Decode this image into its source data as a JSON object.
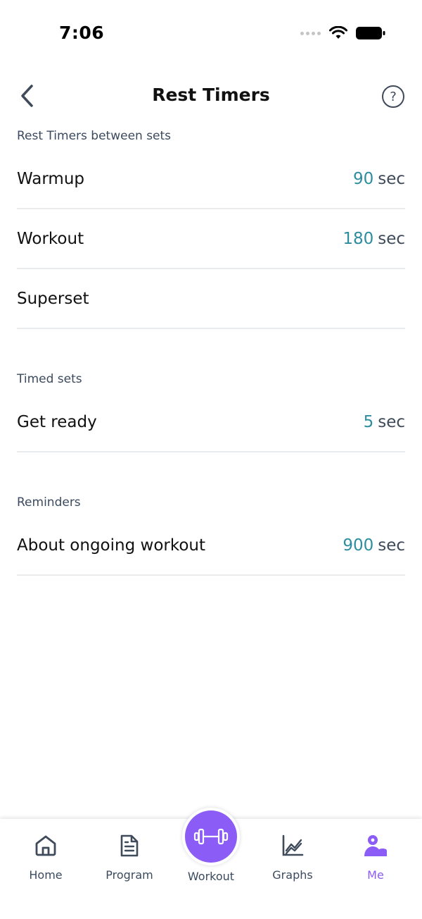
{
  "status_bar": {
    "time": "7:06"
  },
  "header": {
    "title": "Rest Timers",
    "help_label": "?"
  },
  "sections": [
    {
      "title": "Rest Timers between sets",
      "rows": [
        {
          "label": "Warmup",
          "value": "90",
          "unit": "sec"
        },
        {
          "label": "Workout",
          "value": "180",
          "unit": "sec"
        },
        {
          "label": "Superset",
          "value": "",
          "unit": ""
        }
      ]
    },
    {
      "title": "Timed sets",
      "rows": [
        {
          "label": "Get ready",
          "value": "5",
          "unit": "sec"
        }
      ]
    },
    {
      "title": "Reminders",
      "rows": [
        {
          "label": "About ongoing workout",
          "value": "900",
          "unit": "sec"
        }
      ]
    }
  ],
  "tabbar": {
    "items": [
      {
        "label": "Home",
        "icon": "home-icon"
      },
      {
        "label": "Program",
        "icon": "document-icon"
      },
      {
        "label": "Workout",
        "icon": "dumbbell-icon"
      },
      {
        "label": "Graphs",
        "icon": "chart-icon"
      },
      {
        "label": "Me",
        "icon": "user-icon"
      }
    ],
    "active": "Me"
  },
  "colors": {
    "accent": "#8b5cf6",
    "value_teal": "#2e8d9e",
    "text_secondary": "#3b4a5e",
    "divider": "#e9ecef"
  }
}
